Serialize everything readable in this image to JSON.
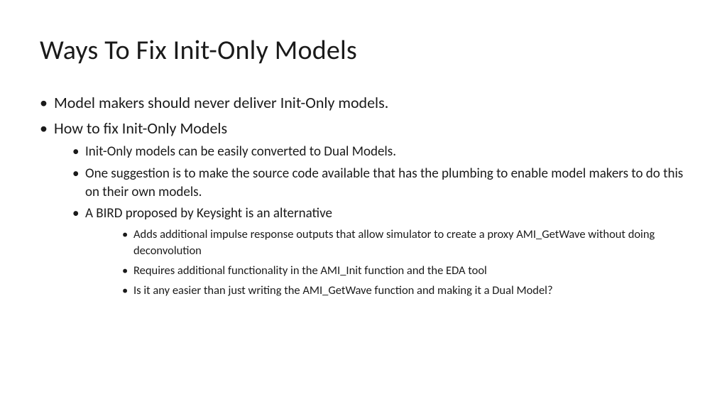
{
  "title": "Ways To Fix Init-Only Models",
  "bullets": {
    "b1": "Model makers should never deliver Init-Only models.",
    "b2": "How to fix Init-Only Models",
    "b2_1": "Init-Only models can be easily converted to Dual Models.",
    "b2_2": "One suggestion is to make the source code available that has the plumbing to enable model makers to do this on their own models.",
    "b2_3": "A BIRD proposed by Keysight is an alternative",
    "b2_3_1": "Adds additional impulse response outputs that allow simulator to create a proxy AMI_GetWave without doing deconvolution",
    "b2_3_2": "Requires additional functionality in the AMI_Init function and the EDA tool",
    "b2_3_3": "Is it any easier than just writing the AMI_GetWave function and making it a Dual Model?"
  }
}
